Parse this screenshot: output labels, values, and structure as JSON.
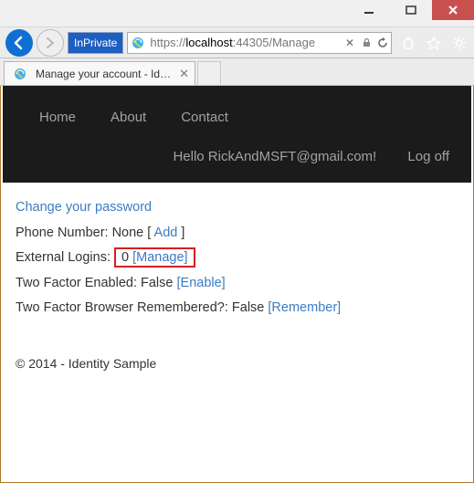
{
  "window": {
    "min": "–",
    "max": "▢",
    "close": "×"
  },
  "browser": {
    "inprivate": "InPrivate",
    "url_prefix": "https://",
    "url_host": "localhost",
    "url_rest": ":44305/Manage",
    "tab_title": "Manage your account - Ide..."
  },
  "nav": {
    "home": "Home",
    "about": "About",
    "contact": "Contact",
    "hello": "Hello RickAndMSFT@gmail.com!",
    "logoff": "Log off"
  },
  "content": {
    "change_pw": "Change your password",
    "phone_label": "Phone Number: None [ ",
    "phone_link": "Add",
    "phone_close": " ]",
    "ext_label": "External Logins:",
    "ext_count": "0 ",
    "ext_link": "[Manage]",
    "twof_label": "Two Factor Enabled: False ",
    "twof_link": "[Enable]",
    "rem_label": "Two Factor Browser Remembered?: False ",
    "rem_link": "[Remember]"
  },
  "footer": "© 2014 - Identity Sample"
}
